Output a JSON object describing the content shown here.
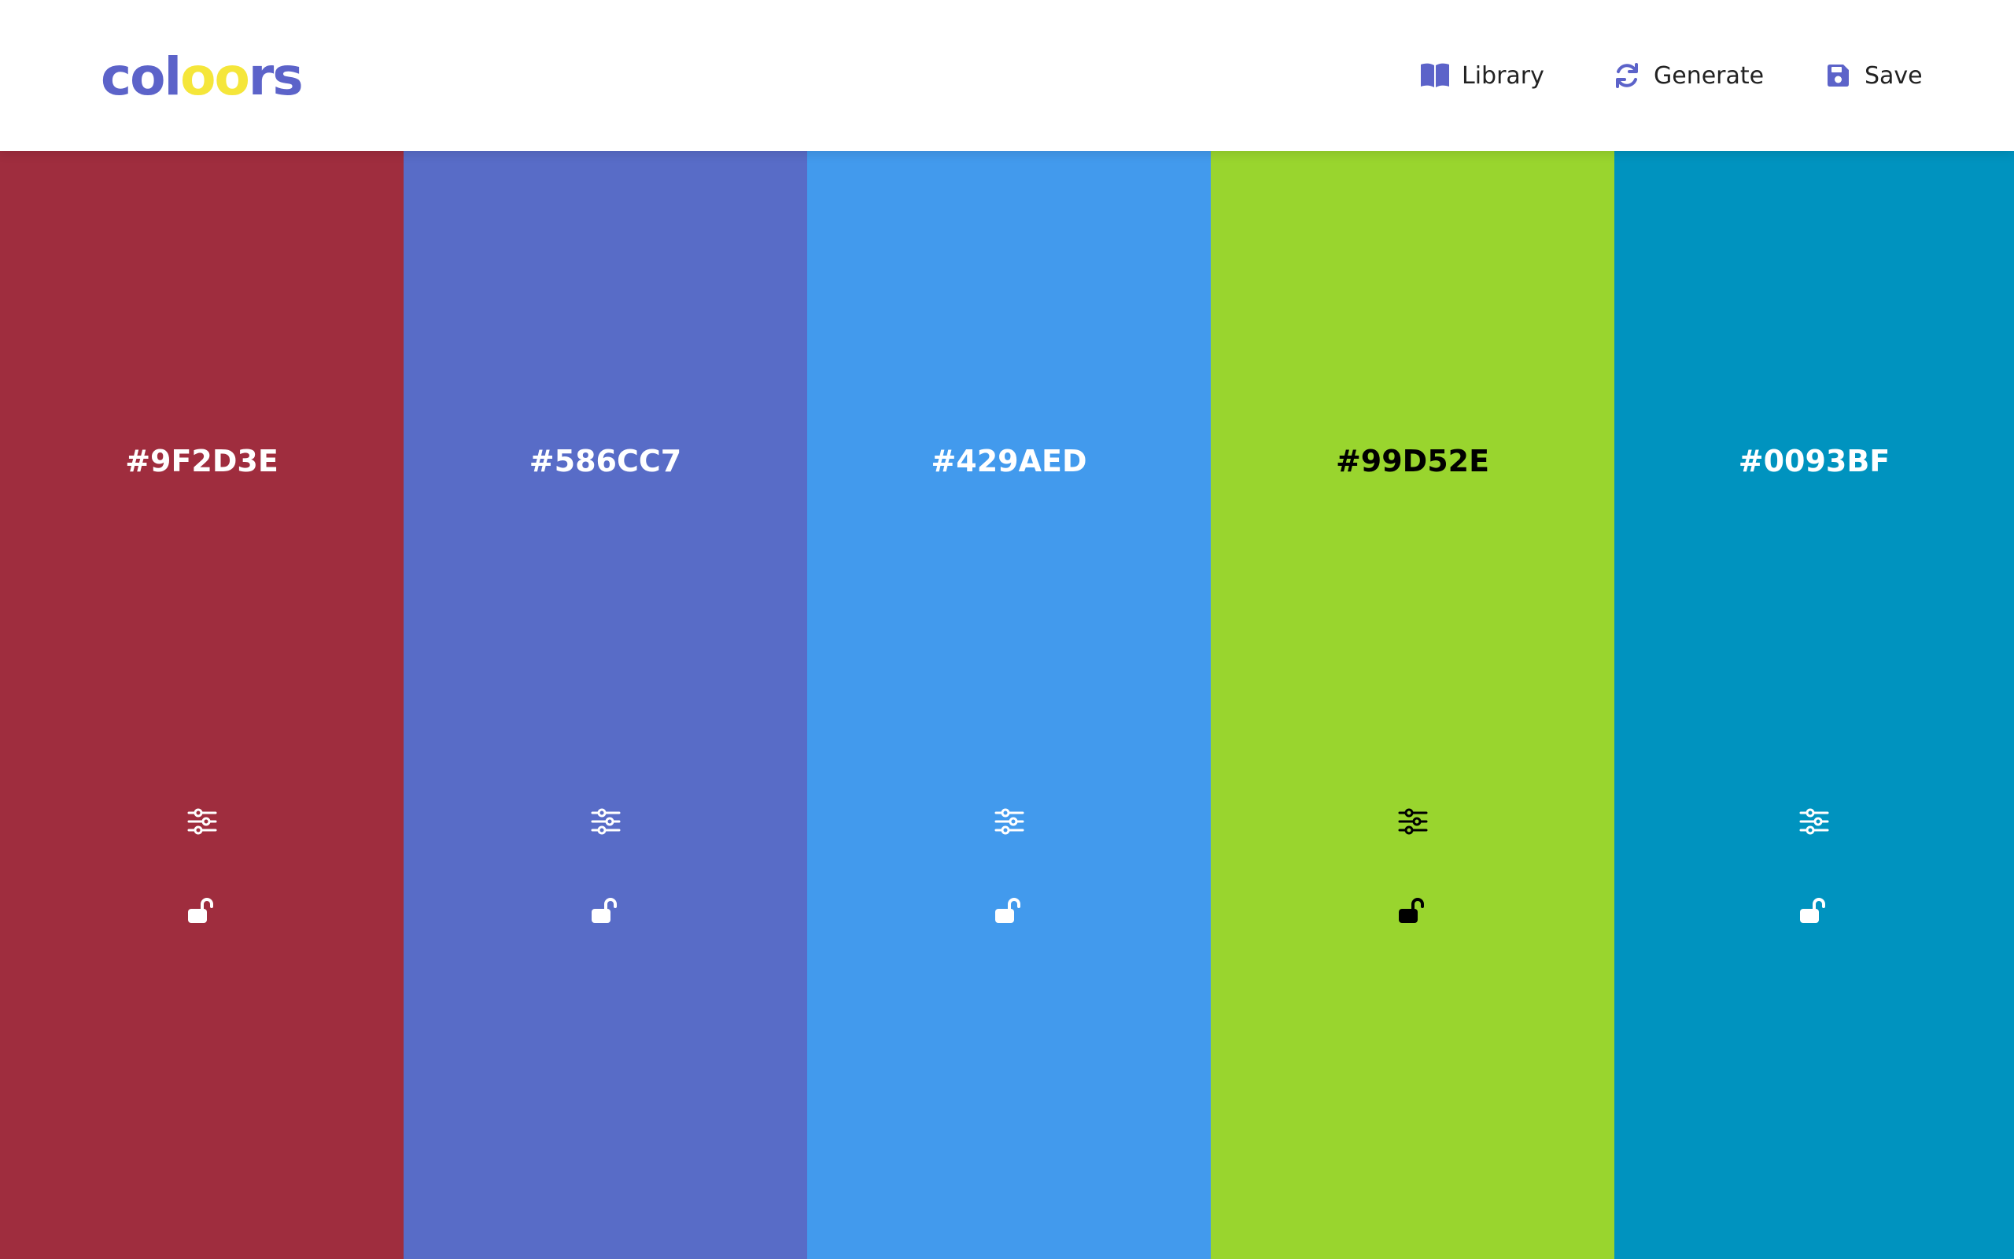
{
  "app": {
    "logo": {
      "letters": [
        "c",
        "o",
        "l",
        "o",
        "o",
        "r",
        "s"
      ],
      "colors": [
        "#5C63C9",
        "#5C63C9",
        "#5C63C9",
        "#F5E63A",
        "#F5E63A",
        "#5C63C9",
        "#5C63C9"
      ]
    },
    "accent": "#5C63C9"
  },
  "nav": {
    "library": {
      "label": "Library",
      "icon": "book-icon"
    },
    "generate": {
      "label": "Generate",
      "icon": "refresh-icon"
    },
    "save": {
      "label": "Save",
      "icon": "floppy-disk-icon"
    }
  },
  "palette": [
    {
      "hex": "#9F2D3E",
      "text_color": "#ffffff",
      "locked": false
    },
    {
      "hex": "#586CC7",
      "text_color": "#ffffff",
      "locked": false
    },
    {
      "hex": "#429AED",
      "text_color": "#ffffff",
      "locked": false
    },
    {
      "hex": "#99D52E",
      "text_color": "#000000",
      "locked": false
    },
    {
      "hex": "#0093BF",
      "text_color": "#ffffff",
      "locked": false
    }
  ]
}
